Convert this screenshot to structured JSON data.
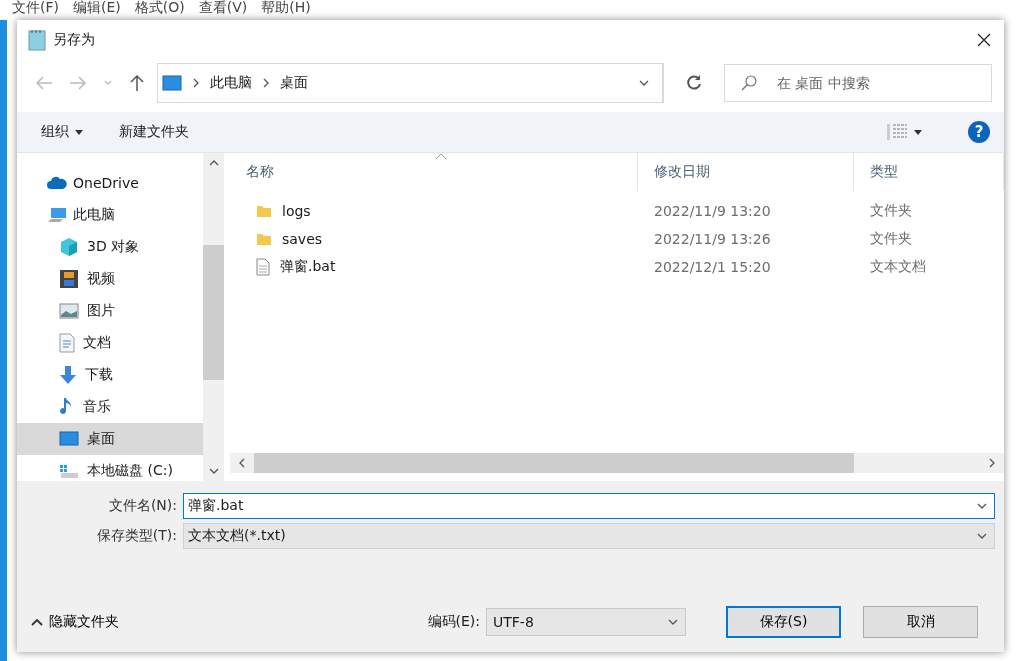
{
  "menu_bar": [
    "文件(F)",
    "编辑(E)",
    "格式(O)",
    "查看(V)",
    "帮助(H)"
  ],
  "window": {
    "title": "另存为"
  },
  "nav": {
    "breadcrumb": [
      "此电脑",
      "桌面"
    ],
    "search": {
      "placeholder": "在 桌面 中搜索"
    }
  },
  "help": "?",
  "toolbar": [
    {
      "label": "组织",
      "kind": "dropdown"
    },
    {
      "label": "新建文件夹",
      "kind": "plain"
    }
  ],
  "sidebar": {
    "items": [
      {
        "label": "OneDrive",
        "kind": "cloud",
        "selected": false
      },
      {
        "label": "此电脑",
        "kind": "computer",
        "selected": false,
        "children": [
          {
            "label": "3D 对象",
            "kind": "cube",
            "selected": false
          },
          {
            "label": "视频",
            "kind": "film",
            "selected": false
          },
          {
            "label": "图片",
            "kind": "picture",
            "selected": false
          },
          {
            "label": "文档",
            "kind": "document",
            "selected": false
          },
          {
            "label": "下载",
            "kind": "download",
            "selected": false
          },
          {
            "label": "音乐",
            "kind": "music",
            "selected": false
          },
          {
            "label": "桌面",
            "kind": "desktop",
            "selected": true
          },
          {
            "label": "本地磁盘 (C:)",
            "kind": "drive",
            "selected": false
          }
        ]
      }
    ]
  },
  "table": {
    "columns": [
      {
        "label": "名称",
        "sorted": true
      },
      {
        "label": "修改日期",
        "sorted": false
      },
      {
        "label": "类型",
        "sorted": false
      }
    ],
    "rows": [
      {
        "kind": "folder",
        "name": "logs",
        "date": "2022/11/9 13:20",
        "type": "文件夹",
        "selected": false
      },
      {
        "kind": "folder",
        "name": "saves",
        "date": "2022/11/9 13:26",
        "type": "文件夹",
        "selected": false
      },
      {
        "kind": "file",
        "name": "弹窗.bat",
        "date": "2022/12/1 15:20",
        "type": "文本文档",
        "selected": false
      }
    ]
  },
  "form": {
    "filename": {
      "label": "文件名(N):",
      "value": "弹窗.bat"
    },
    "filetype": {
      "label": "保存类型(T):",
      "value": "文本文档(*.txt)"
    }
  },
  "footer": {
    "toggle": "隐藏文件夹",
    "encoding": {
      "label": "编码(E):",
      "value": "UTF-8"
    },
    "buttons": [
      {
        "label": "保存(S)",
        "default": true
      },
      {
        "label": "取消",
        "default": false
      }
    ]
  }
}
